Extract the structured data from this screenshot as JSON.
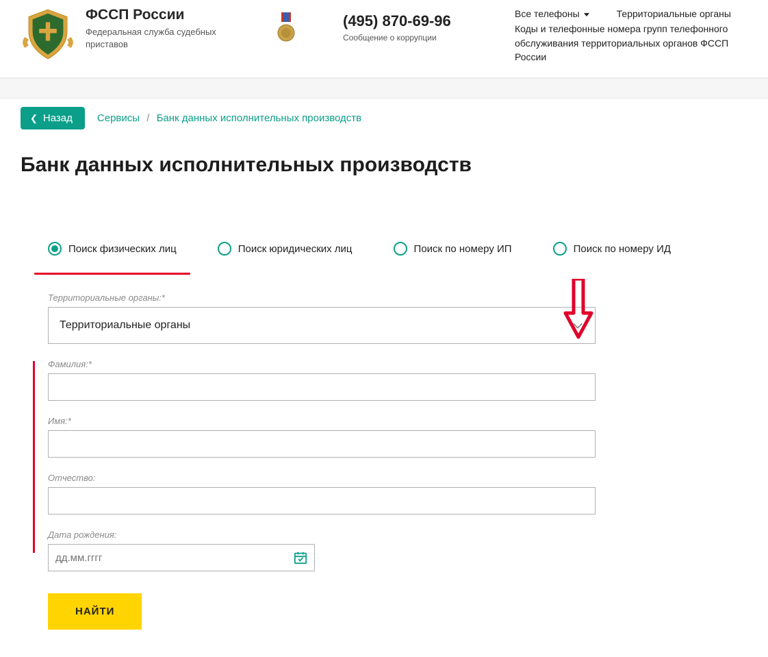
{
  "header": {
    "brand_title": "ФССП России",
    "brand_subtitle": "Федеральная служба судебных приставов",
    "phone": "(495) 870-69-96",
    "phone_label": "Сообщение о коррупции",
    "link_all_phones": "Все телефоны",
    "link_territorial": "Территориальные органы",
    "link_codes": "Коды и телефонные номера групп телефонного обслуживания территориальных органов ФССП России"
  },
  "nav": {
    "back": "Назад",
    "crumb_services": "Сервисы",
    "crumb_current": "Банк данных исполнительных производств"
  },
  "page_title": "Банк данных исполнительных производств",
  "tabs": {
    "t1": "Поиск физических лиц",
    "t2": "Поиск юридических лиц",
    "t3": "Поиск по номеру ИП",
    "t4": "Поиск по номеру ИД"
  },
  "form": {
    "territory_label": "Территориальные органы:*",
    "territory_value": "Территориальные органы",
    "lastname_label": "Фамилия:*",
    "firstname_label": "Имя:*",
    "middlename_label": "Отчество:",
    "dob_label": "Дата рождения:",
    "dob_placeholder": "дд.мм.гггг",
    "submit": "НАЙТИ"
  }
}
